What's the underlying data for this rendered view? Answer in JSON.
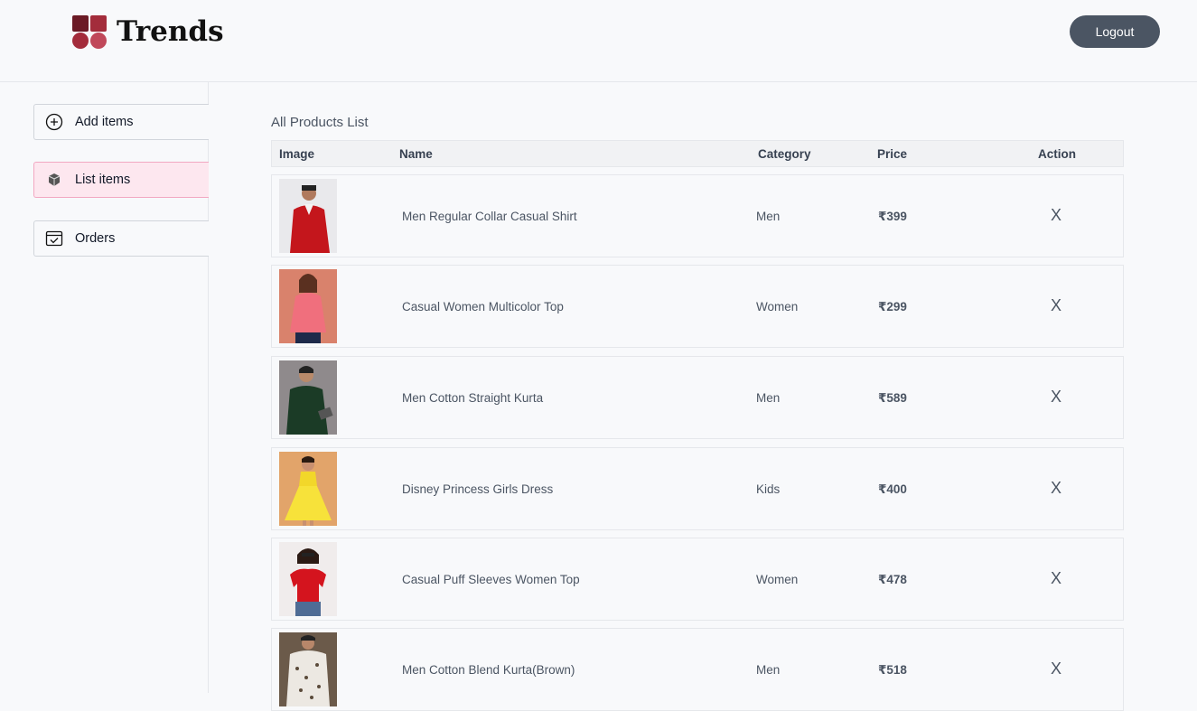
{
  "brand": {
    "name": "Trends",
    "colors": {
      "dark": "#6b1a25",
      "mid": "#a32c3b",
      "light": "#c0485a"
    }
  },
  "header": {
    "logout_label": "Logout"
  },
  "sidebar": {
    "items": [
      {
        "label": "Add items",
        "icon": "plus-circle-icon"
      },
      {
        "label": "List items",
        "icon": "box-icon",
        "active": true
      },
      {
        "label": "Orders",
        "icon": "calendar-check-icon"
      }
    ]
  },
  "products": {
    "title": "All Products List",
    "columns": [
      "Image",
      "Name",
      "Category",
      "Price",
      "Action"
    ],
    "remove_label": "X",
    "rows": [
      {
        "name": "Men Regular Collar Casual Shirt",
        "category": "Men",
        "price": "₹399",
        "image": "man-red-shirt"
      },
      {
        "name": "Casual Women Multicolor Top",
        "category": "Women",
        "price": "₹299",
        "image": "woman-pink-top"
      },
      {
        "name": "Men Cotton Straight Kurta",
        "category": "Men",
        "price": "₹589",
        "image": "man-green-kurta"
      },
      {
        "name": "Disney Princess Girls Dress",
        "category": "Kids",
        "price": "₹400",
        "image": "girl-yellow-dress"
      },
      {
        "name": "Casual Puff Sleeves Women Top",
        "category": "Women",
        "price": "₹478",
        "image": "woman-red-top"
      },
      {
        "name": "Men Cotton Blend Kurta(Brown)",
        "category": "Men",
        "price": "₹518",
        "image": "man-floral-kurta"
      }
    ]
  }
}
